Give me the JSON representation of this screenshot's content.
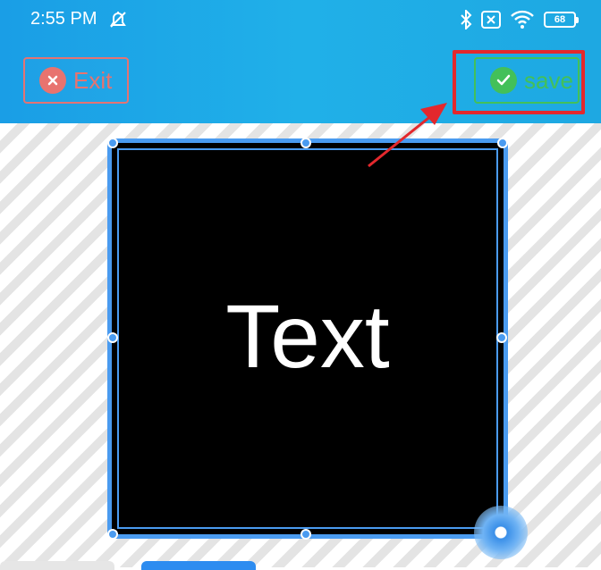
{
  "status_bar": {
    "time": "2:55 PM",
    "battery": "68"
  },
  "toolbar": {
    "exit_label": "Exit",
    "save_label": "save"
  },
  "canvas": {
    "text": "Text"
  },
  "colors": {
    "header_blue": "#1aa3e6",
    "exit_red": "#e8736f",
    "save_green": "#43c059",
    "highlight_red": "#e3282d",
    "selection_blue": "#4a9bf0"
  }
}
